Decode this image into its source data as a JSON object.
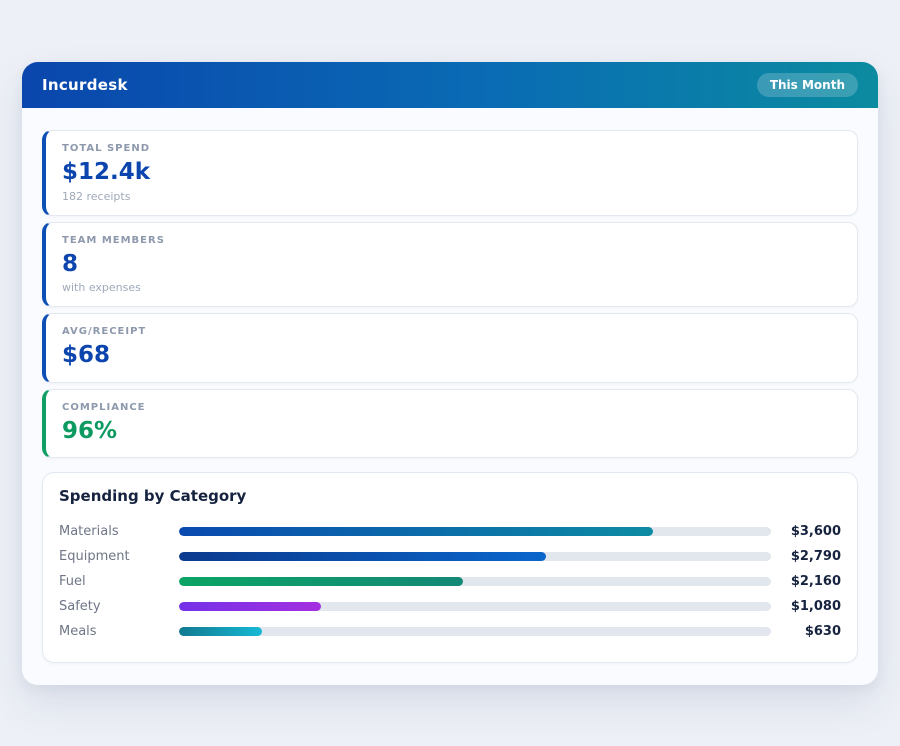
{
  "header": {
    "title": "Incurdesk",
    "badge": "This Month"
  },
  "stats": [
    {
      "label": "TOTAL SPEND",
      "value": "$12.4k",
      "sub": "182 receipts",
      "accent": "#0d4fb5",
      "value_color": "#0d45ae"
    },
    {
      "label": "TEAM MEMBERS",
      "value": "8",
      "sub": "with expenses",
      "accent": "#0d4fb5",
      "value_color": "#0d45ae"
    },
    {
      "label": "AVG/RECEIPT",
      "value": "$68",
      "accent": "#0d4fb5",
      "value_color": "#0d45ae"
    },
    {
      "label": "COMPLIANCE",
      "value": "96%",
      "accent": "#0f9e63",
      "value_color": "#0c9a60"
    }
  ],
  "chart_data": {
    "type": "bar",
    "orientation": "horizontal",
    "title": "Spending by Category",
    "categories": [
      "Materials",
      "Equipment",
      "Fuel",
      "Safety",
      "Meals"
    ],
    "values": [
      3600,
      2790,
      2160,
      1080,
      630
    ],
    "value_labels": [
      "$3,600",
      "$2,790",
      "$2,160",
      "$1,080",
      "$630"
    ],
    "xlim": [
      0,
      4500
    ],
    "grid": false,
    "legend": false,
    "track_color": "#e2e7ee",
    "bar_gradients": [
      [
        "#0a4ab0",
        "#0d8ba3"
      ],
      [
        "#0b3a8e",
        "#0a66cc"
      ],
      [
        "#0ba465",
        "#148877"
      ],
      [
        "#7431e8",
        "#a42fe0"
      ],
      [
        "#11798f",
        "#16b9d5"
      ]
    ]
  }
}
